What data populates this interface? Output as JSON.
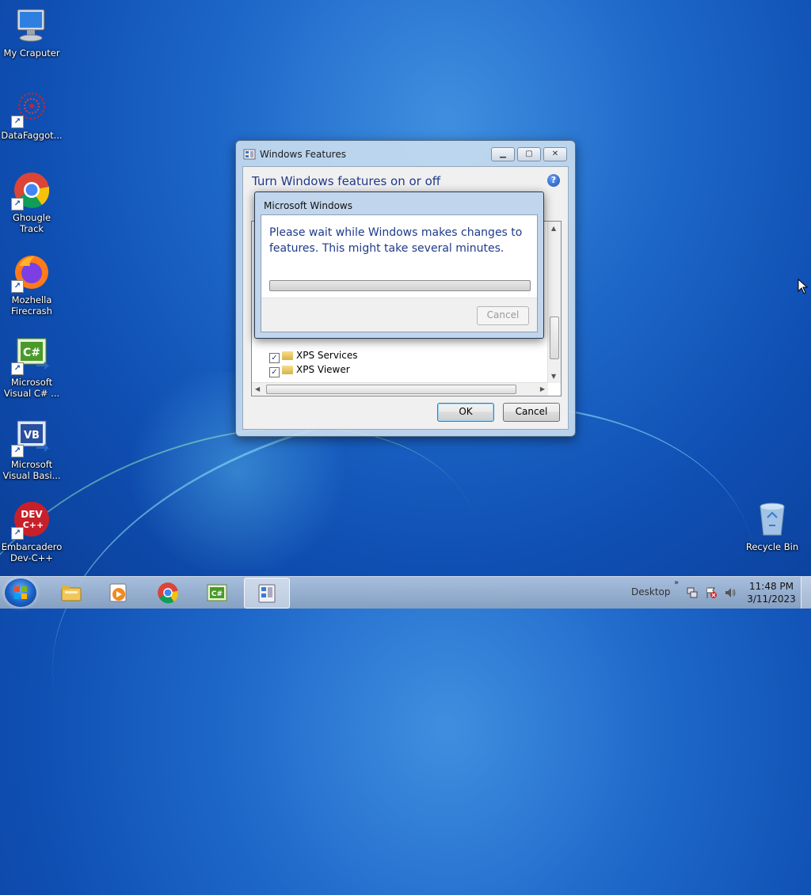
{
  "desktop_icons": [
    {
      "label": "My Craputer",
      "icon": "computer-icon"
    },
    {
      "label": "DataFaggot...",
      "icon": "datafaggot-icon"
    },
    {
      "label": "Ghougle Track",
      "icon": "chrome-icon"
    },
    {
      "label": "Mozhella Firecrash",
      "icon": "firefox-icon"
    },
    {
      "label": "Microsoft Visual C# ...",
      "icon": "visual-csharp-icon"
    },
    {
      "label": "Microsoft Visual Basi...",
      "icon": "visual-basic-icon"
    },
    {
      "label": "Embarcadero Dev-C++",
      "icon": "dev-cpp-icon"
    },
    {
      "label": "Recycle Bin",
      "icon": "recycle-bin-icon"
    }
  ],
  "features_window": {
    "title": "Windows Features",
    "heading": "Turn Windows features on or off",
    "help_glyph": "?",
    "features": [
      {
        "label": "XPS Services",
        "checked": true
      },
      {
        "label": "XPS Viewer",
        "checked": true
      }
    ],
    "ok_label": "OK",
    "cancel_label": "Cancel"
  },
  "progress_dialog": {
    "title": "Microsoft Windows",
    "message": "Please wait while Windows makes changes to features. This might take several minutes.",
    "cancel_label": "Cancel",
    "cancel_enabled": false
  },
  "taskbar": {
    "desktop_label": "Desktop",
    "time": "11:48 PM",
    "date": "3/11/2023",
    "pinned": [
      "explorer-icon",
      "media-player-icon",
      "chrome-icon",
      "visual-csharp-icon",
      "windows-features-icon"
    ]
  },
  "colors": {
    "accent_text": "#1e3a8a",
    "desktop_blue": "#1e68c9"
  }
}
